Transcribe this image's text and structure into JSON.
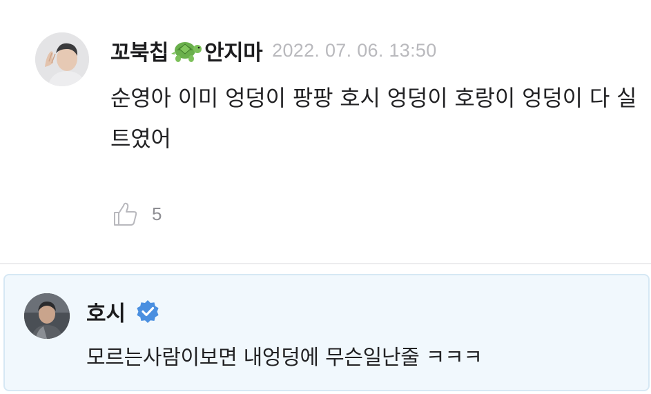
{
  "comment": {
    "author_name": "꼬북칩",
    "author_suffix": "안지마",
    "timestamp": "2022. 07. 06. 13:50",
    "body": "순영아 이미 엉덩이 팡팡 호시 엉덩이 호랑이 엉덩이 다 실트였어",
    "like_count": "5",
    "icons": {
      "name_emoji": "turtle-icon",
      "like": "thumbs-up-icon"
    }
  },
  "reply": {
    "author_name": "호시",
    "body": "모르는사람이보면 내엉덩에 무슨일난줄 ㅋㅋㅋ",
    "icons": {
      "badge": "verified-badge-icon"
    }
  },
  "colors": {
    "reply_background": "#f1f8fd",
    "reply_border": "#d6e8f4",
    "verified_badge": "#4a8fe0",
    "timestamp": "#b9b9bd",
    "like_count": "#8e8e93"
  }
}
